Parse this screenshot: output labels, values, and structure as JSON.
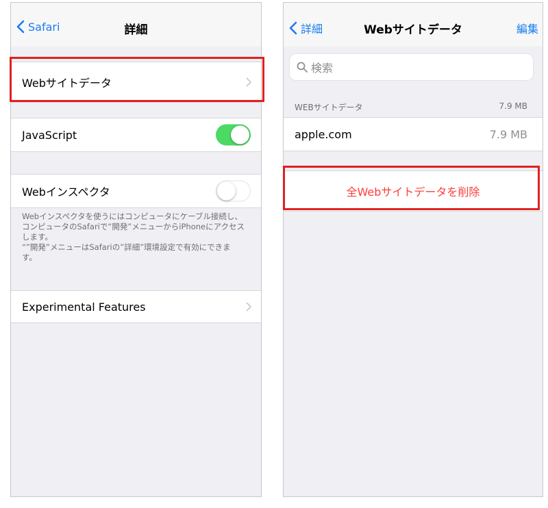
{
  "left": {
    "nav": {
      "back_label": "Safari",
      "title": "詳細"
    },
    "website_data_label": "Webサイトデータ",
    "javascript": {
      "label": "JavaScript",
      "enabled": true
    },
    "web_inspector": {
      "label": "Webインスペクタ",
      "enabled": false,
      "footer_line1": "Webインスペクタを使うにはコンピュータにケーブル接続し、",
      "footer_line2": "コンピュータのSafariで“開発”メニューからiPhoneにアクセス",
      "footer_line3": "します。",
      "footer_line4": "“”開発”メニューはSafariの”詳細”環境設定で有効にできま",
      "footer_line5": "す。"
    },
    "experimental_features_label": "Experimental Features"
  },
  "right": {
    "nav": {
      "back_label": "詳細",
      "title": "Webサイトデータ",
      "edit_label": "編集"
    },
    "search_placeholder": "検索",
    "section_header": {
      "label": "WEBサイトデータ",
      "total": "7.9 MB"
    },
    "sites": [
      {
        "domain": "apple.com",
        "size": "7.9 MB"
      }
    ],
    "delete_all_label": "全Webサイトデータを削除"
  },
  "colors": {
    "accent": "#1a7cf0",
    "toggle_on": "#4cd964",
    "destructive": "#fc3d39",
    "highlight": "#e02020"
  }
}
